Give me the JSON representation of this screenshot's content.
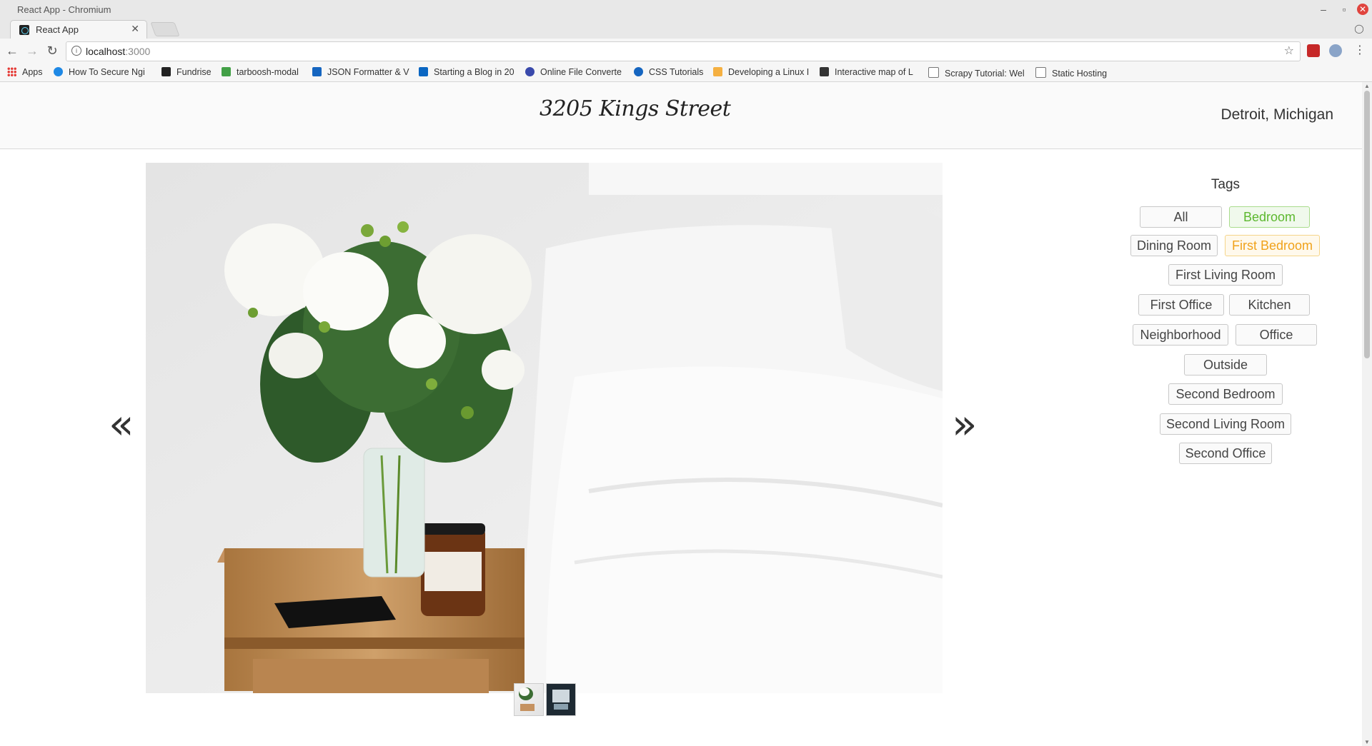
{
  "window": {
    "title": "React App - Chromium"
  },
  "tab": {
    "title": "React App"
  },
  "omnibox": {
    "host": "localhost",
    "port": ":3000"
  },
  "bookmarks": {
    "apps": "Apps",
    "items": [
      "How To Secure Ngi",
      "Fundrise",
      "tarboosh-modal",
      "JSON Formatter & V",
      "Starting a Blog in 20",
      "Online File Converte",
      "CSS Tutorials",
      "Developing a Linux I",
      "Interactive map of L",
      "Scrapy Tutorial: Wel",
      "Static Hosting"
    ]
  },
  "header": {
    "brand": "3205 Kings Street",
    "location": "Detroit, Michigan"
  },
  "slider": {
    "prev": "«",
    "next": "»"
  },
  "tags": {
    "title": "Tags",
    "items": [
      "All",
      "Bedroom",
      "Dining Room",
      "First Bedroom",
      "First Living Room",
      "First Office",
      "Kitchen",
      "Neighborhood",
      "Office",
      "Outside",
      "Second Bedroom",
      "Second Living Room",
      "Second Office"
    ],
    "colors": {
      "green": "#5cb82e",
      "orange": "#f0a21b"
    }
  }
}
